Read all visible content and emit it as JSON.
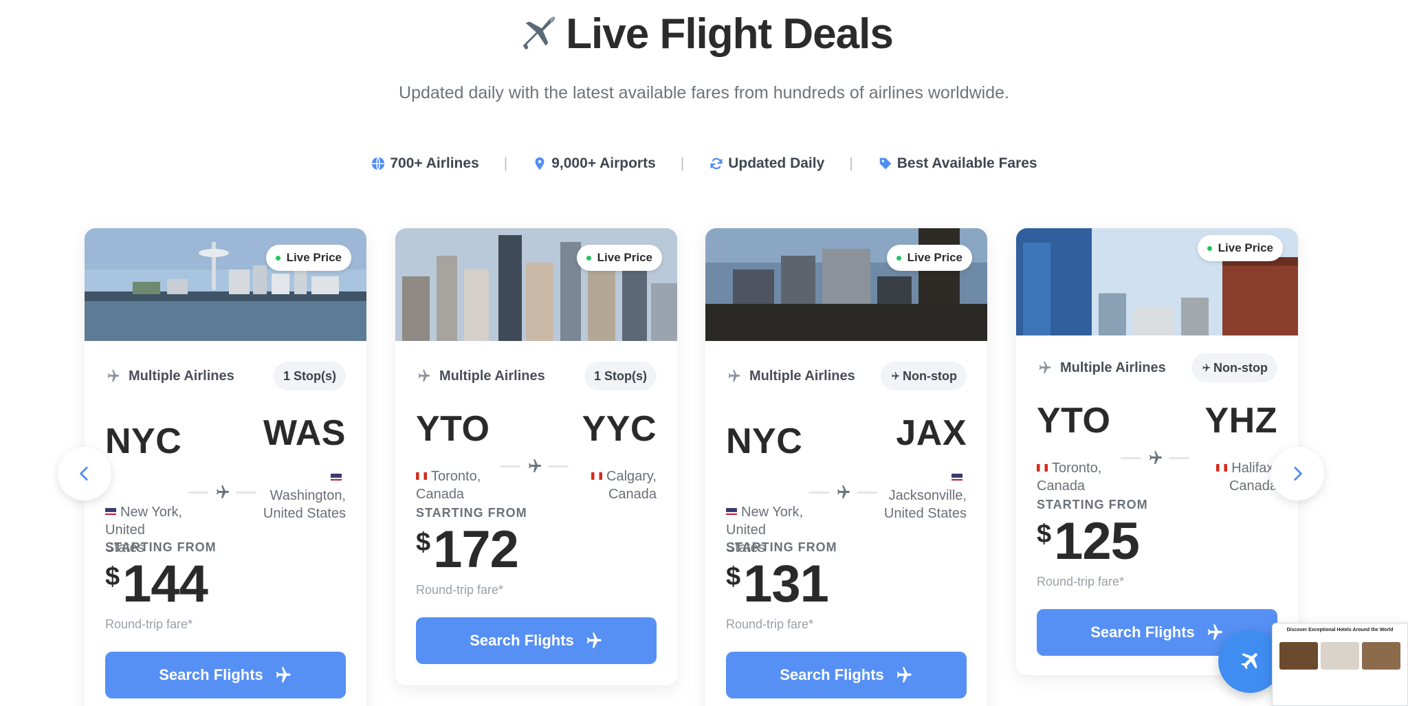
{
  "header": {
    "title": "Live Flight Deals",
    "subtitle": "Updated daily with the latest available fares from hundreds of airlines worldwide."
  },
  "features": [
    {
      "icon": "globe-icon",
      "label": "700+ Airlines"
    },
    {
      "icon": "map-pin-icon",
      "label": "9,000+ Airports"
    },
    {
      "icon": "refresh-icon",
      "label": "Updated Daily"
    },
    {
      "icon": "tag-icon",
      "label": "Best Available Fares"
    }
  ],
  "cards": [
    {
      "live_label": "Live Price",
      "airline": "Multiple Airlines",
      "stops": "1 Stop(s)",
      "origin_code": "NYC",
      "origin_city": "New York, United States",
      "dest_code": "WAS",
      "dest_city": "Washington, United States",
      "starting_label": "STARTING FROM",
      "currency": "$",
      "price": "144",
      "fare_note": "Round-trip fare*",
      "button": "Search Flights"
    },
    {
      "live_label": "Live Price",
      "airline": "Multiple Airlines",
      "stops": "1 Stop(s)",
      "origin_code": "YTO",
      "origin_city": "Toronto, Canada",
      "dest_code": "YYC",
      "dest_city": "Calgary, Canada",
      "starting_label": "STARTING FROM",
      "currency": "$",
      "price": "172",
      "fare_note": "Round-trip fare*",
      "button": "Search Flights"
    },
    {
      "live_label": "Live Price",
      "airline": "Multiple Airlines",
      "stops": "Non-stop",
      "origin_code": "NYC",
      "origin_city": "New York, United States",
      "dest_code": "JAX",
      "dest_city": "Jacksonville, United States",
      "starting_label": "STARTING FROM",
      "currency": "$",
      "price": "131",
      "fare_note": "Round-trip fare*",
      "button": "Search Flights"
    },
    {
      "live_label": "Live Price",
      "airline": "Multiple Airlines",
      "stops": "Non-stop",
      "origin_code": "YTO",
      "origin_city": "Toronto, Canada",
      "dest_code": "YHZ",
      "dest_city": "Halifax, Canada",
      "starting_label": "STARTING FROM",
      "currency": "$",
      "price": "125",
      "fare_note": "Round-trip fare*",
      "button": "Search Flights"
    }
  ],
  "preview": {
    "title": "Discover Exceptional Hotels Around the World"
  },
  "colors": {
    "accent": "#5790f4",
    "live_dot": "#22c55e",
    "text_dark": "#2a2a2a",
    "muted": "#6a6f76"
  }
}
